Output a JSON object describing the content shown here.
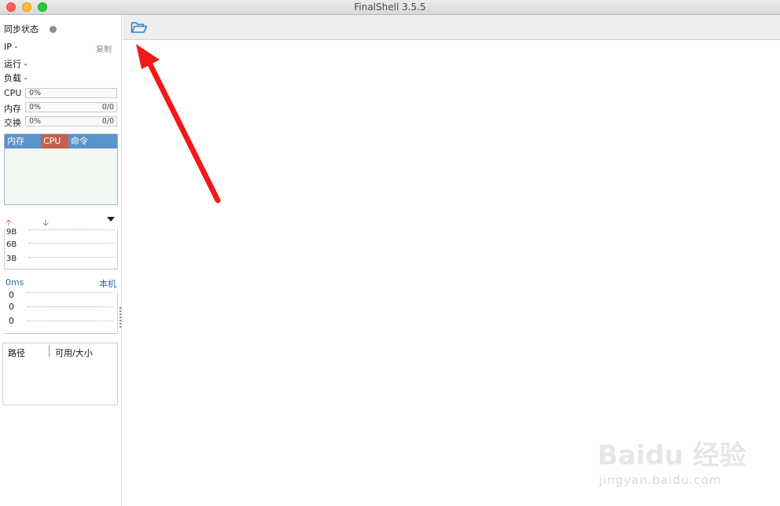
{
  "window": {
    "title": "FinalShell 3.5.5"
  },
  "sidebar": {
    "sync_status_label": "同步状态",
    "ip_label": "IP  -",
    "copy_label": "复制",
    "uptime_label": "运行 -",
    "load_label": "负载 -",
    "cpu": {
      "label": "CPU",
      "percent": "0%"
    },
    "memory": {
      "label": "内存",
      "percent": "0%",
      "value": "0/0"
    },
    "swap": {
      "label": "交换",
      "percent": "0%",
      "value": "0/0"
    },
    "process_tabs": [
      "内存",
      "CPU",
      "命令"
    ],
    "network": {
      "y_labels": [
        "9B",
        "6B",
        "3B"
      ]
    },
    "ping": {
      "latency": "0ms",
      "host": "本机",
      "values": [
        "0",
        "0",
        "0"
      ]
    },
    "disk": {
      "columns": [
        "路径",
        "可用/大小"
      ]
    }
  },
  "toolbar": {
    "open_icon": "folder-open-icon"
  },
  "watermark": {
    "brand": "Baidu 经验",
    "url": "jingyan.baidu.com"
  },
  "colors": {
    "accent": "#5b93cc",
    "cpu_tab": "#c6604c",
    "arrow": "#f01a1a"
  }
}
